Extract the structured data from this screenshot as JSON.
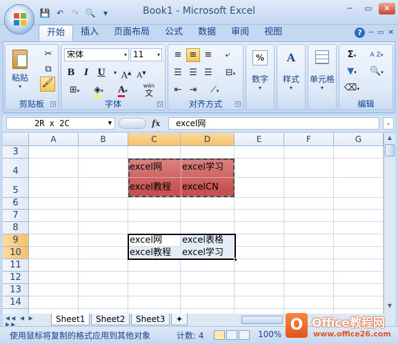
{
  "window": {
    "title": "Book1 - Microsoft Excel"
  },
  "qat": {
    "save": "💾",
    "undo": "↶",
    "redo": "↷",
    "print_preview": "🔍",
    "more": "▾"
  },
  "win_controls": {
    "minimize": "─",
    "restore": "▭",
    "close": "✕"
  },
  "tabs": [
    "开始",
    "插入",
    "页面布局",
    "公式",
    "数据",
    "审阅",
    "视图"
  ],
  "ribbon_right": {
    "help": "?",
    "min": "─",
    "restore": "▭",
    "close": "✕"
  },
  "ribbon": {
    "clipboard": {
      "label": "剪贴板",
      "paste": "粘贴"
    },
    "font": {
      "label": "字体",
      "name": "宋体",
      "size": "11",
      "bold": "B",
      "italic": "I",
      "underline": "U",
      "grow": "A",
      "shrink": "A",
      "wen": "wén",
      "wen_char": "文"
    },
    "alignment": {
      "label": "对齐方式"
    },
    "number": {
      "label": "数字",
      "icon": "%"
    },
    "styles": {
      "label": "样式",
      "icon": "A"
    },
    "cells": {
      "label": "单元格"
    },
    "editing": {
      "label": "编辑",
      "sum": "Σ",
      "sort": "A Z"
    }
  },
  "formula_bar": {
    "name_box": "2R x 2C",
    "fx": "fx",
    "content": "excel网"
  },
  "columns": [
    "A",
    "B",
    "C",
    "D",
    "E",
    "F",
    "G"
  ],
  "rows": [
    "3",
    "4",
    "5",
    "6",
    "7",
    "8",
    "9",
    "10",
    "11",
    "12",
    "13",
    "14"
  ],
  "cells": {
    "C4": "excel网",
    "D4": "excel学习",
    "C5": "excel教程",
    "D5": "excelCN",
    "C9": "excel网",
    "D9": "excel表格",
    "C10": "excel教程",
    "D10": "excel学习"
  },
  "sheet_tabs": [
    "Sheet1",
    "Sheet2",
    "Sheet3"
  ],
  "status": {
    "message": "使用鼠标将复制的格式应用到其他对象",
    "count": "计数: 4",
    "zoom": "100%"
  },
  "watermark": {
    "brand": "Office教程网",
    "url": "www.office26.com"
  },
  "colors": {
    "selection_fill": "#c6524f",
    "header_selected": "#f6c069"
  }
}
